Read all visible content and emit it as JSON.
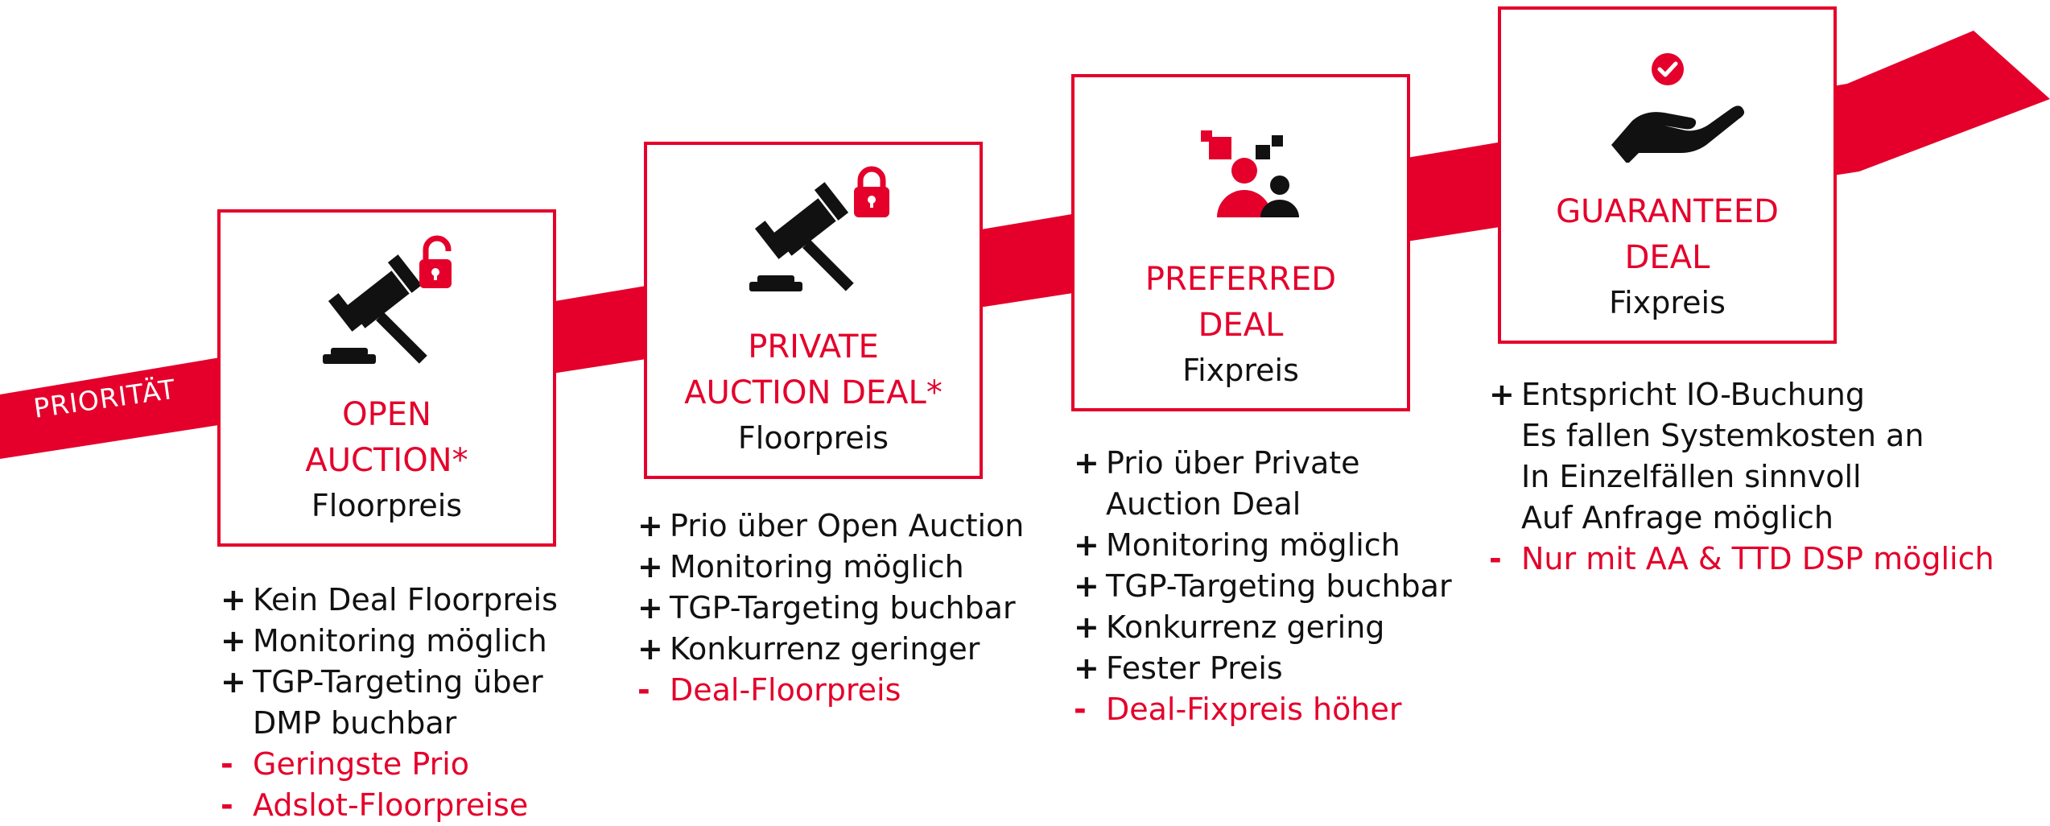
{
  "colors": {
    "accent": "#e4002b",
    "text": "#111111",
    "background": "#ffffff"
  },
  "arrow": {
    "label": "PRIORITÄT"
  },
  "stages": [
    {
      "icon": "gavel-unlocked-icon",
      "title_line1": "OPEN",
      "title_line2": "AUCTION*",
      "subtitle": "Floorpreis",
      "points": [
        {
          "sign": "+",
          "text": "Kein Deal Floorpreis"
        },
        {
          "sign": "+",
          "text": "Monitoring möglich"
        },
        {
          "sign": "+",
          "text": "TGP-Targeting über",
          "cont": "DMP buchbar"
        },
        {
          "sign": "-",
          "text": "Geringste Prio"
        },
        {
          "sign": "-",
          "text": "Adslot-Floorpreise"
        }
      ]
    },
    {
      "icon": "gavel-locked-icon",
      "title_line1": "PRIVATE",
      "title_line2": "AUCTION DEAL*",
      "subtitle": "Floorpreis",
      "points": [
        {
          "sign": "+",
          "text": "Prio über Open Auction"
        },
        {
          "sign": "+",
          "text": "Monitoring möglich"
        },
        {
          "sign": "+",
          "text": "TGP-Targeting buchbar"
        },
        {
          "sign": "+",
          "text": "Konkurrenz geringer"
        },
        {
          "sign": "-",
          "text": "Deal-Floorpreis"
        }
      ]
    },
    {
      "icon": "people-icon",
      "title_line1": "PREFERRED",
      "title_line2": "DEAL",
      "subtitle": "Fixpreis",
      "points": [
        {
          "sign": "+",
          "text": "Prio über Private",
          "cont": "Auction Deal"
        },
        {
          "sign": "+",
          "text": "Monitoring möglich"
        },
        {
          "sign": "+",
          "text": "TGP-Targeting buchbar"
        },
        {
          "sign": "+",
          "text": "Konkurrenz gering"
        },
        {
          "sign": "+",
          "text": "Fester Preis"
        },
        {
          "sign": "-",
          "text": "Deal-Fixpreis höher"
        }
      ]
    },
    {
      "icon": "hand-check-icon",
      "title_line1": "GUARANTEED",
      "title_line2": "DEAL",
      "subtitle": "Fixpreis",
      "points": [
        {
          "sign": "+",
          "text": "Entspricht IO-Buchung"
        },
        {
          "sign": "",
          "text": "Es fallen Systemkosten an"
        },
        {
          "sign": "",
          "text": "In Einzelfällen sinnvoll"
        },
        {
          "sign": "",
          "text": "Auf Anfrage möglich"
        },
        {
          "sign": "-",
          "text": "Nur mit AA & TTD DSP möglich"
        }
      ]
    }
  ]
}
